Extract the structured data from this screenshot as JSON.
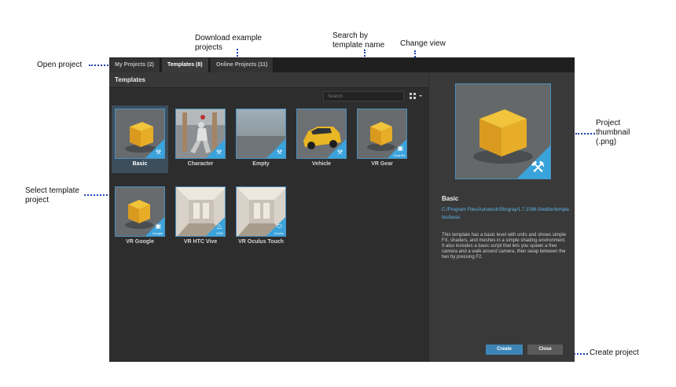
{
  "annotations": {
    "download": "Download example projects",
    "search": "Search by template name",
    "change_view": "Change view",
    "open_project": "Open project",
    "select_template": "Select template project",
    "thumbnail": "Project thumbnail (.png)",
    "create_project": "Create project"
  },
  "tabs": [
    {
      "label": "My Projects (2)"
    },
    {
      "label": "Templates (8)"
    },
    {
      "label": "Online Projects (11)"
    }
  ],
  "templates_header": "Templates",
  "search": {
    "placeholder": "Search"
  },
  "templates": [
    {
      "label": "Basic",
      "icon": "hammer-icon"
    },
    {
      "label": "Character",
      "icon": "hammer-icon"
    },
    {
      "label": "Empty",
      "icon": "hammer-icon"
    },
    {
      "label": "Vehicle",
      "icon": "hammer-icon"
    },
    {
      "label": "VR Gear",
      "icon": "vr-headset-icon",
      "badge": "GearVR"
    },
    {
      "label": "VR Google",
      "icon": "cardboard-icon",
      "badge": "Google"
    },
    {
      "label": "VR HTC Vive",
      "icon": "vive-icon",
      "badge": "VIVE"
    },
    {
      "label": "VR Oculus Touch",
      "icon": "oculus-icon",
      "badge": "Oculus"
    }
  ],
  "details": {
    "title": "Basic",
    "path": "C:/Program Files/Autodesk/Stingray/1.7.1096.0/editor/templates/basic",
    "description": "This template has a basic level with units and shows simple FX, shaders, and meshes in a simple shading environment. It also includes a basic script that lets you spawn a free camera and a walk around camera, then swap between the two by pressing F2."
  },
  "buttons": {
    "create": "Create",
    "close": "Close"
  },
  "colors": {
    "accent": "#3ba3dc",
    "cube": "#e8b42a",
    "create_button": "#3d85b7"
  }
}
